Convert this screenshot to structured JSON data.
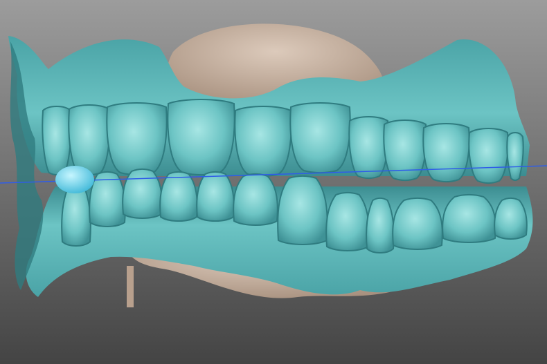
{
  "viewer": {
    "background_top": "#9c9c9c",
    "background_bottom": "#444444",
    "reference_line_color": "#2f5de8"
  },
  "model": {
    "scan_color": "#6cc4c4",
    "scan_shadow": "#2f7c80",
    "scan_highlight": "#a7e6e4",
    "palate_color": "#c6b09e",
    "marker_color": "#5fd8ee"
  }
}
